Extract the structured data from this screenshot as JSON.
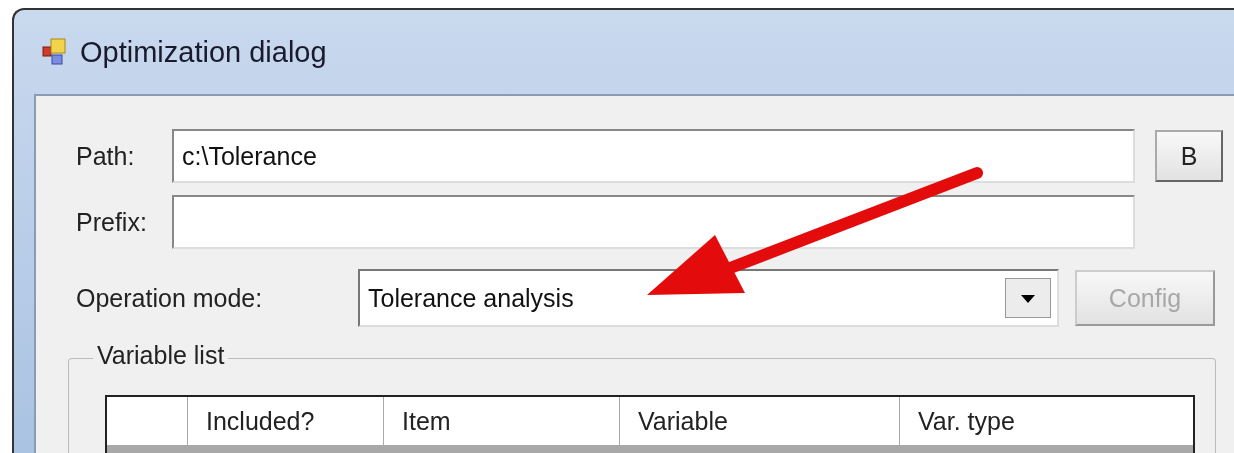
{
  "window": {
    "title": "Optimization dialog"
  },
  "path": {
    "label": "Path:",
    "value": "c:\\Tolerance",
    "browse_button": "B"
  },
  "prefix": {
    "label": "Prefix:"
  },
  "operation_mode": {
    "label": "Operation mode:",
    "value": "Tolerance analysis",
    "config_button": {
      "label": "Config",
      "disabled": true
    }
  },
  "variable_list": {
    "title": "Variable list",
    "columns": [
      "Included?",
      "Item",
      "Variable",
      "Var. type"
    ]
  }
}
